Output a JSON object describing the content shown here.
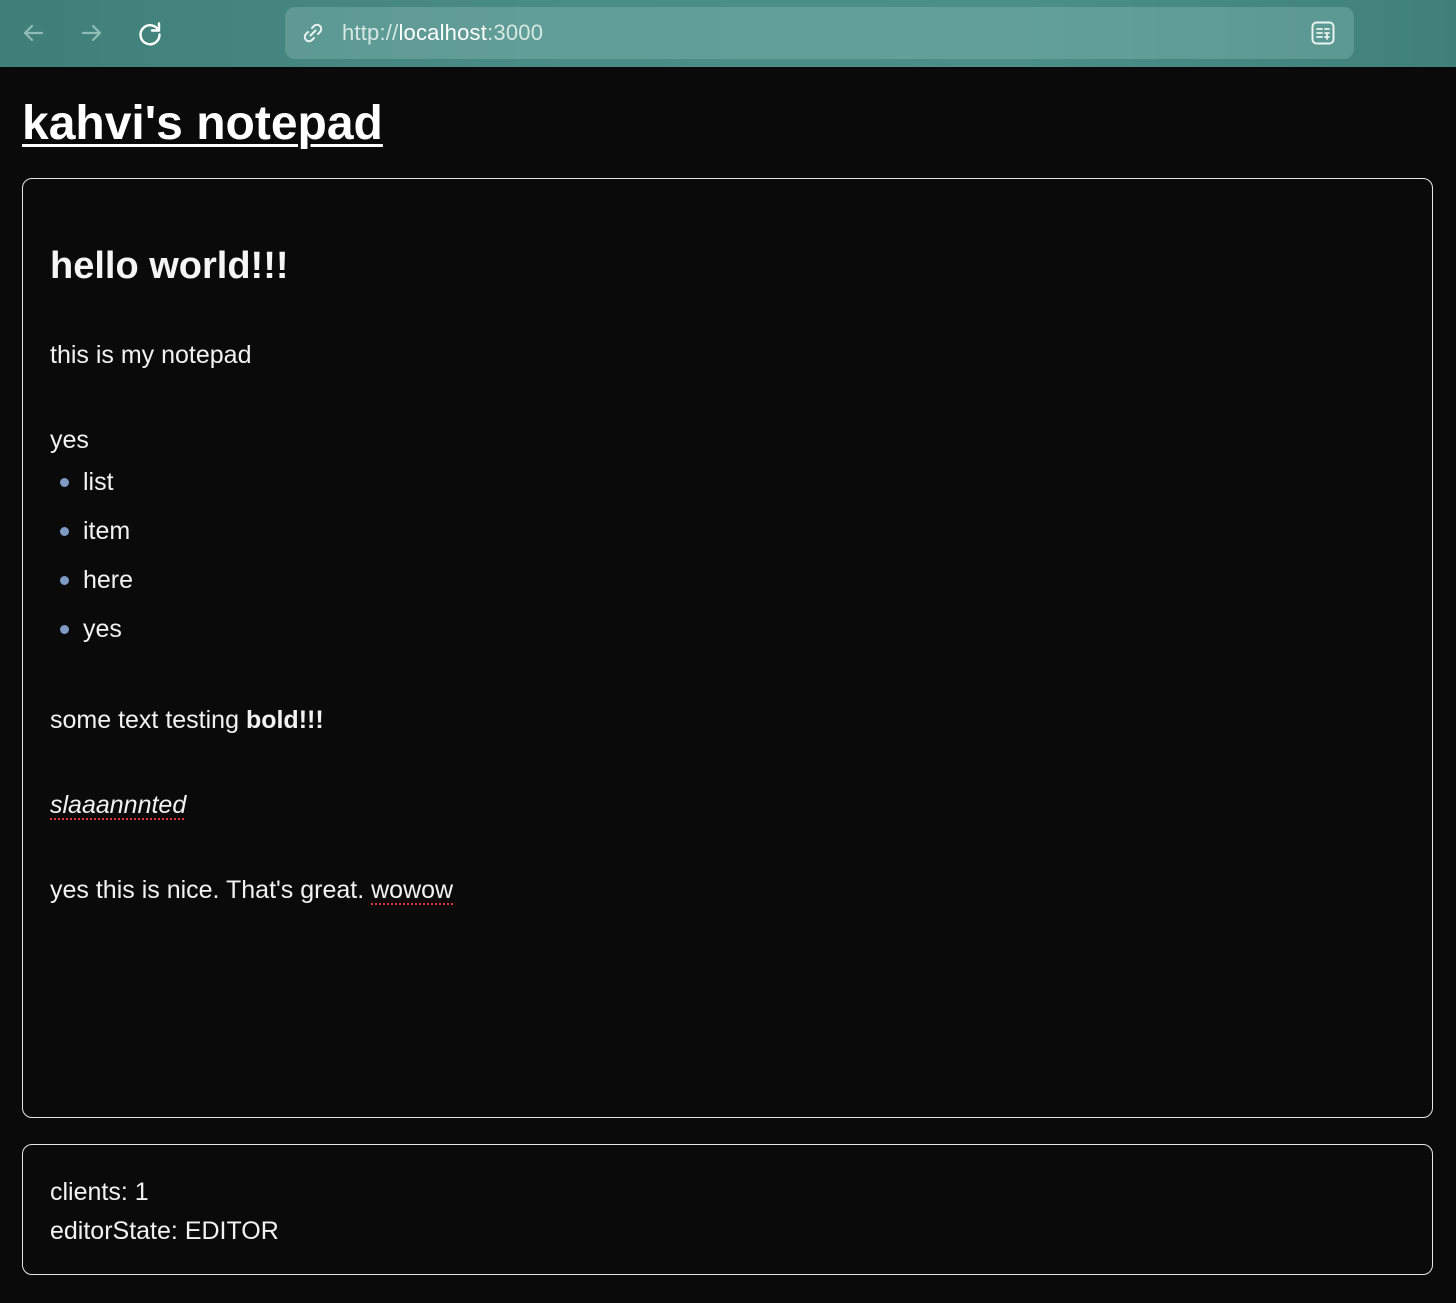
{
  "browser": {
    "url_scheme": "http://",
    "url_host": "localhost",
    "url_port": ":3000",
    "colors": {
      "toolbar": "#4a8d86",
      "url_field": "#6aa6a0"
    },
    "icons": [
      "back-arrow-icon",
      "forward-arrow-icon",
      "reload-icon",
      "site-info-icon",
      "reader-view-icon"
    ]
  },
  "page": {
    "title": "kahvi's notepad",
    "background": "#0a0a0a"
  },
  "editor": {
    "heading": "hello world!!!",
    "paragraph_1": "this is my notepad",
    "paragraph_2": "yes",
    "list_items": [
      "list",
      "item",
      "here",
      "yes"
    ],
    "paragraph_3_prefix": "some text testing ",
    "paragraph_3_bold": "bold!!!",
    "paragraph_4_italic": "slaaannnted",
    "paragraph_5_prefix": "yes this is nice. That's great. ",
    "paragraph_5_misspelled": "wowow"
  },
  "status": {
    "clients_label": "clients: ",
    "clients_value": "1",
    "editor_state_label": "editorState: ",
    "editor_state_value": "EDITOR"
  }
}
